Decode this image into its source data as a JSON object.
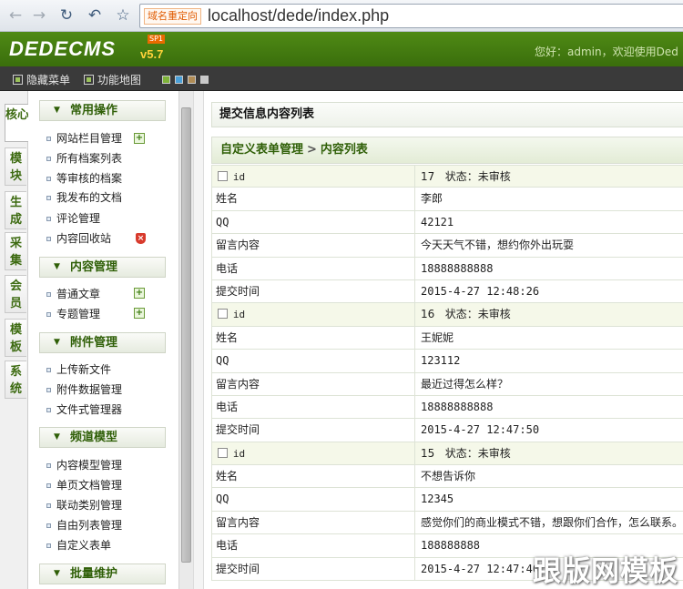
{
  "browser": {
    "tag": "域名重定向",
    "url": "localhost/dede/index.php"
  },
  "header": {
    "logo": "DEDECMS",
    "version": "v5.7",
    "sp": "SP1",
    "welcome": "您好：admin，欢迎使用Ded"
  },
  "toolbar": {
    "hide_menu": "隐藏菜单",
    "func_map": "功能地图",
    "swatches": [
      "#7fb33a",
      "#4aa0d8",
      "#b08c55",
      "#c9c9c9"
    ]
  },
  "left_tabs": [
    "核心",
    "模块",
    "生成",
    "采集",
    "会员",
    "模板",
    "系统"
  ],
  "sidebar": {
    "sections": [
      {
        "title": "常用操作",
        "items": [
          "网站栏目管理",
          "所有档案列表",
          "等审核的档案",
          "我发布的文档",
          "评论管理",
          "内容回收站"
        ]
      },
      {
        "title": "内容管理",
        "items": [
          "普通文章",
          "专题管理"
        ]
      },
      {
        "title": "附件管理",
        "items": [
          "上传新文件",
          "附件数据管理",
          "文件式管理器"
        ]
      },
      {
        "title": "频道模型",
        "items": [
          "内容模型管理",
          "单页文档管理",
          "联动类别管理",
          "自由列表管理",
          "自定义表单"
        ]
      },
      {
        "title": "批量维护",
        "items": []
      }
    ]
  },
  "main": {
    "title": "提交信息内容列表",
    "breadcrumb": {
      "part1": "自定义表单管理",
      "sep": ">",
      "part2": "内容列表"
    },
    "records": [
      {
        "id_label": "id",
        "id": "17",
        "status_label": "状态：",
        "status": "未审核",
        "fields": [
          [
            "姓名",
            "李郎"
          ],
          [
            "QQ",
            "42121"
          ],
          [
            "留言内容",
            "今天天气不错，想约你外出玩耍"
          ],
          [
            "电话",
            "18888888888"
          ],
          [
            "提交时间",
            "2015-4-27 12:48:26"
          ]
        ]
      },
      {
        "id_label": "id",
        "id": "16",
        "status_label": "状态：",
        "status": "未审核",
        "fields": [
          [
            "姓名",
            "王妮妮"
          ],
          [
            "QQ",
            "123112"
          ],
          [
            "留言内容",
            "最近过得怎么样？"
          ],
          [
            "电话",
            "18888888888"
          ],
          [
            "提交时间",
            "2015-4-27 12:47:50"
          ]
        ]
      },
      {
        "id_label": "id",
        "id": "15",
        "status_label": "状态：",
        "status": "未审核",
        "fields": [
          [
            "姓名",
            "不想告诉你"
          ],
          [
            "QQ",
            "12345"
          ],
          [
            "留言内容",
            "感觉你们的商业模式不错，想跟你们合作，怎么联系。"
          ],
          [
            "电话",
            "188888888"
          ],
          [
            "提交时间",
            "2015-4-27 12:47:40"
          ]
        ]
      }
    ]
  },
  "watermark": "跟版网模板"
}
